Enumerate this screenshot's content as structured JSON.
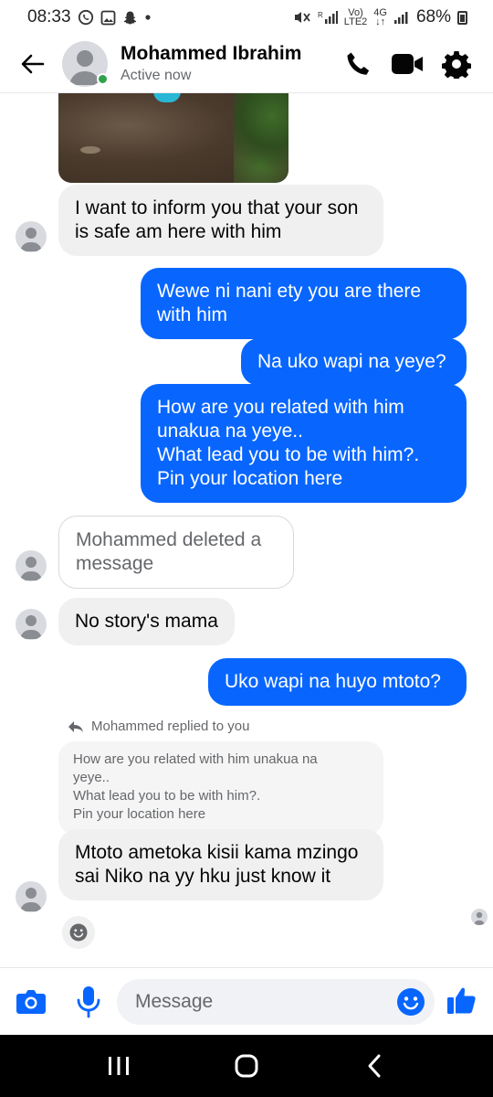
{
  "status_bar": {
    "time": "08:33",
    "network_top": "Vo)",
    "network_bottom": "LTE2",
    "net_4g_top": "4G",
    "net_4g_bottom": "↓↑",
    "battery": "68%"
  },
  "header": {
    "contact_name": "Mohammed Ibrahim",
    "status": "Active now",
    "active_color": "#31a24c",
    "icons": [
      "back-arrow-icon",
      "phone-icon",
      "video-camera-icon",
      "gear-icon"
    ]
  },
  "messages": [
    {
      "direction": "in",
      "text": "I want to inform you that your son is safe am here with him"
    },
    {
      "direction": "out",
      "text": "Wewe ni nani ety you are there with him"
    },
    {
      "direction": "out",
      "text": "Na uko wapi na yeye?"
    },
    {
      "direction": "out",
      "lines": [
        "How are you related with him unakua na yeye..",
        "What lead you to be with him?.",
        "Pin your location  here"
      ]
    },
    {
      "direction": "in",
      "deleted": true,
      "text": "Mohammed deleted a message"
    },
    {
      "direction": "in",
      "text": "No story's mama"
    },
    {
      "direction": "out",
      "text": "Uko wapi na huyo mtoto?"
    },
    {
      "direction": "in",
      "text": "Mtoto ametoka kisii kama mzingo sai Niko na yy hku just know it"
    }
  ],
  "reply": {
    "note": "Mohammed replied to you",
    "quoted_lines": [
      "How are you related with him unakua na",
      "yeye..",
      "What lead you to be with him?.",
      "Pin your location  here"
    ]
  },
  "composer": {
    "placeholder": "Message",
    "icons": [
      "camera-icon",
      "microphone-icon",
      "emoji-icon",
      "thumbs-up-icon"
    ]
  },
  "colors": {
    "outgoing_bubble": "#0866ff",
    "incoming_bubble": "#f0f0f0",
    "accent": "#0866ff"
  }
}
